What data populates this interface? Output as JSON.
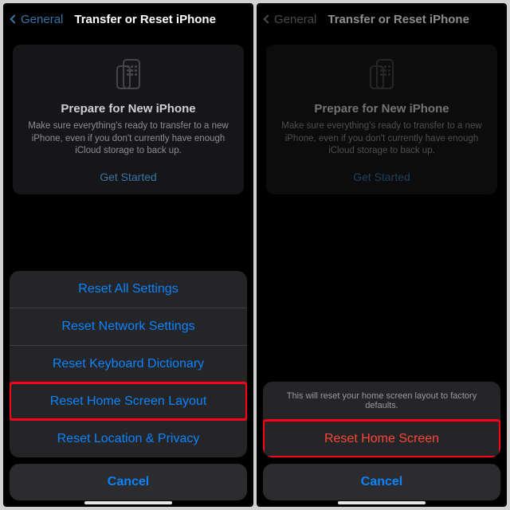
{
  "nav": {
    "back": "General",
    "title": "Transfer or Reset iPhone"
  },
  "prepare": {
    "title": "Prepare for New iPhone",
    "desc": "Make sure everything's ready to transfer to a new iPhone, even if you don't currently have enough iCloud storage to back up.",
    "cta": "Get Started"
  },
  "sheetLeft": {
    "options": [
      "Reset All Settings",
      "Reset Network Settings",
      "Reset Keyboard Dictionary",
      "Reset Home Screen Layout",
      "Reset Location & Privacy"
    ],
    "highlightIndex": 3,
    "cancel": "Cancel"
  },
  "sheetRight": {
    "message": "This will reset your home screen layout to factory defaults.",
    "action": "Reset Home Screen",
    "cancel": "Cancel"
  }
}
